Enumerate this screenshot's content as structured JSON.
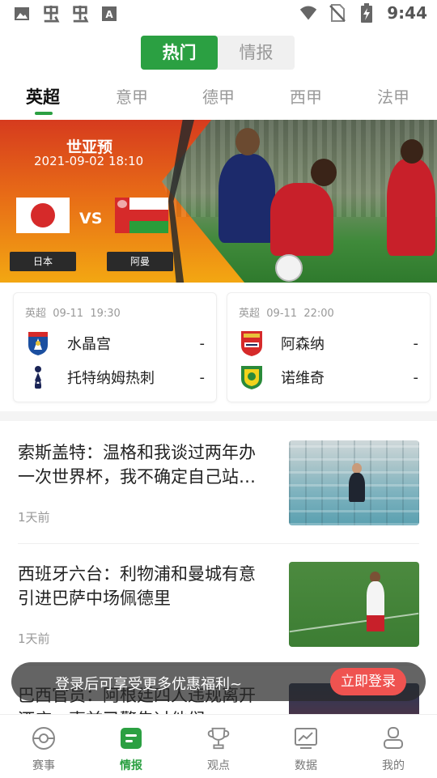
{
  "status_bar": {
    "time": "9:44",
    "left_icons": [
      "image-icon",
      "app-icon",
      "app-icon",
      "font-a-icon"
    ],
    "right_icons": [
      "wifi-icon",
      "no-sim-icon",
      "battery-icon"
    ]
  },
  "top_toggle": {
    "options": [
      "热门",
      "情报"
    ],
    "active_index": 0
  },
  "leagues": {
    "items": [
      "英超",
      "意甲",
      "德甲",
      "西甲",
      "法甲"
    ],
    "active_index": 0
  },
  "banner": {
    "competition": "世亚预",
    "datetime": "2021-09-02 18:10",
    "vs_text": "VS",
    "home_team": "日本",
    "away_team": "阿曼"
  },
  "matches": [
    {
      "league": "英超",
      "date": "09-11",
      "time": "19:30",
      "home": {
        "name": "水晶宫",
        "score": "-",
        "crest": "crystal-palace-crest-icon"
      },
      "away": {
        "name": "托特纳姆热刺",
        "score": "-",
        "crest": "tottenham-crest-icon"
      }
    },
    {
      "league": "英超",
      "date": "09-11",
      "time": "22:00",
      "home": {
        "name": "阿森纳",
        "score": "-",
        "crest": "arsenal-crest-icon"
      },
      "away": {
        "name": "诺维奇",
        "score": "-",
        "crest": "norwich-crest-icon"
      }
    }
  ],
  "news": [
    {
      "title": "索斯盖特：温格和我谈过两年办一次世界杯，我不确定自己站…",
      "time": "1天前"
    },
    {
      "title": "西班牙六台：利物浦和曼城有意引进巴萨中场佩德里",
      "time": "1天前"
    },
    {
      "title": "巴西官员：阿根廷四人违规离开酒店，事前已警告过他们",
      "time": ""
    }
  ],
  "toast": {
    "message": "登录后可享受更多优惠福利~",
    "button": "立即登录"
  },
  "bottom_nav": {
    "items": [
      {
        "label": "赛事",
        "icon": "football-icon"
      },
      {
        "label": "情报",
        "icon": "intel-icon"
      },
      {
        "label": "观点",
        "icon": "trophy-icon"
      },
      {
        "label": "数据",
        "icon": "chart-icon"
      },
      {
        "label": "我的",
        "icon": "profile-icon"
      }
    ],
    "active_index": 1
  },
  "colors": {
    "accent": "#2ba042",
    "toast_button": "#ef5350",
    "muted": "#999999"
  }
}
